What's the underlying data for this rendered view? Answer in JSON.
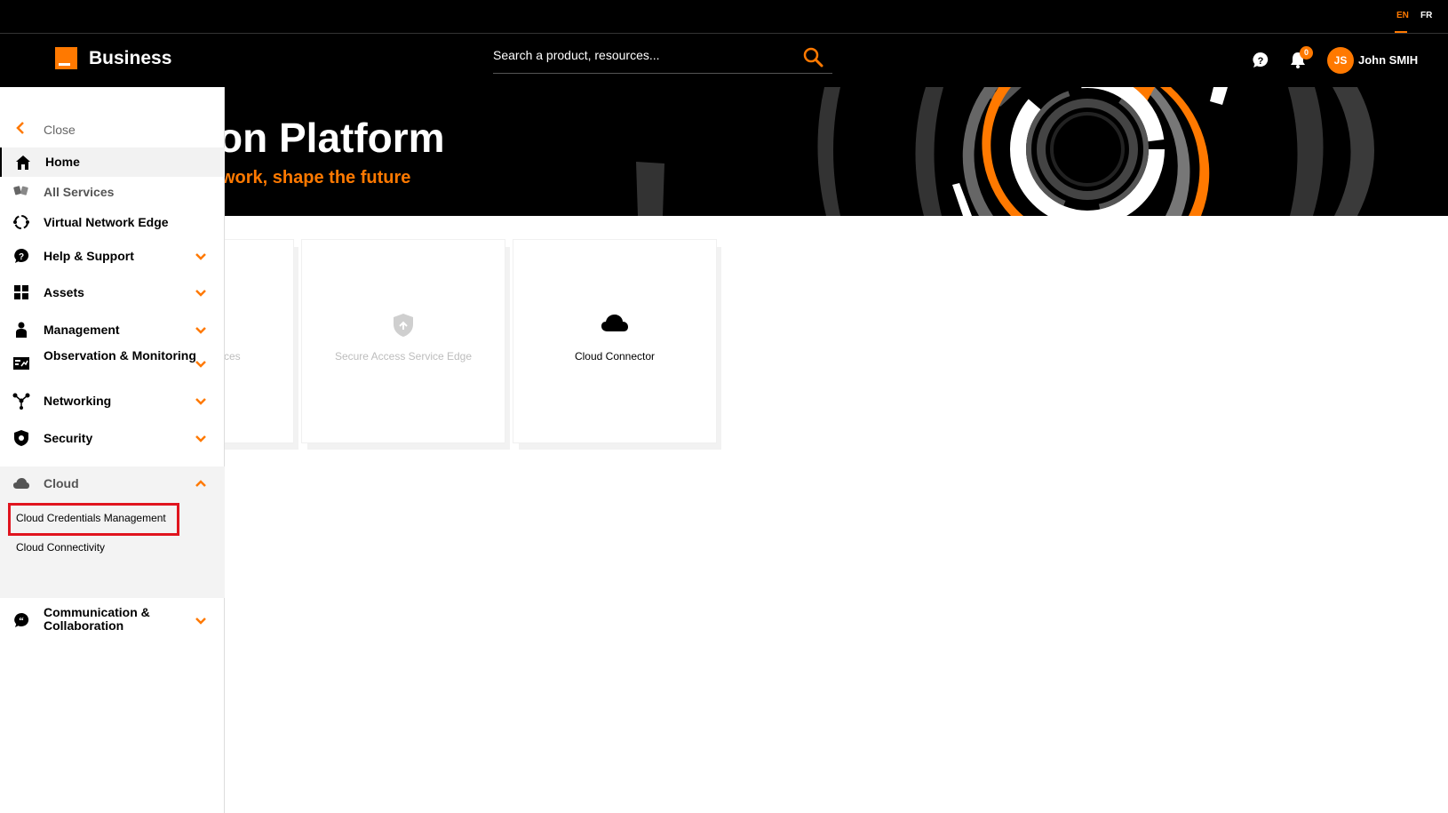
{
  "lang_bar": {
    "en": "EN",
    "fr": "FR"
  },
  "header": {
    "brand": "Business",
    "search_placeholder": "Search a product, resources...",
    "notification_count": "0",
    "avatar_initials": "JS",
    "user_name": "John SMIH"
  },
  "hero": {
    "title": "on Platform",
    "subtitle": "work, shape the future"
  },
  "cards": [
    {
      "label": "ces",
      "state": "dim"
    },
    {
      "label": "Secure Access Service Edge",
      "icon": "shield-icon",
      "state": "dim"
    },
    {
      "label": "Cloud Connector",
      "icon": "cloud-icon",
      "state": "active"
    }
  ],
  "sidebar": {
    "close_label": "Close",
    "items": [
      {
        "label": "Home",
        "icon": "home-icon",
        "selected": true
      },
      {
        "label": "All Services",
        "icon": "services-icon"
      },
      {
        "label": "Virtual Network Edge",
        "icon": "vne-icon"
      },
      {
        "label": "Help & Support",
        "icon": "help-icon",
        "expandable": true
      },
      {
        "label": "Assets",
        "icon": "grid-icon",
        "expandable": true
      },
      {
        "label": "Management",
        "icon": "person-icon",
        "expandable": true
      },
      {
        "label": "Observation & Monitoring",
        "icon": "monitor-icon",
        "expandable": true
      },
      {
        "label": "Networking",
        "icon": "network-icon",
        "expandable": true
      },
      {
        "label": "Security",
        "icon": "shield-icon",
        "expandable": true
      },
      {
        "label": "Cloud",
        "icon": "cloud-icon",
        "expandable": true,
        "expanded": true
      },
      {
        "label": "Communication & Collaboration",
        "icon": "chat-icon",
        "expandable": true
      }
    ],
    "cloud_subitems": [
      {
        "label": "Cloud Credentials Management",
        "highlighted": true
      },
      {
        "label": "Cloud Connectivity"
      }
    ]
  },
  "colors": {
    "accent": "#ff7900",
    "highlight": "#e0141e",
    "header_bg": "#000000"
  }
}
